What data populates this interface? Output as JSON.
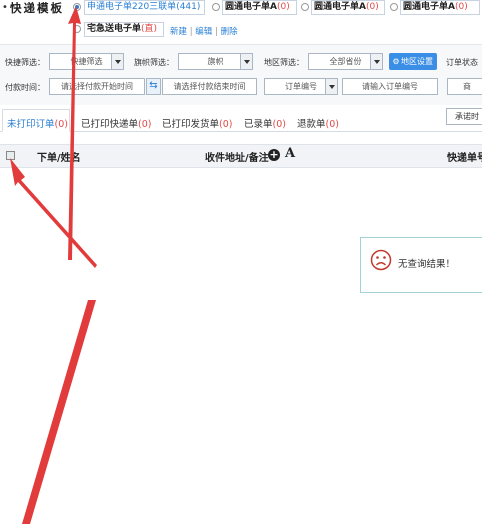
{
  "template_bar": {
    "title": "快递模板",
    "templates": [
      {
        "name": "申通电子单220三联单",
        "count": "(441)",
        "selected": true
      },
      {
        "name": "圆通电子单A",
        "count": "(0)",
        "selected": false
      },
      {
        "name": "圆通电子单A",
        "count": "(0)",
        "selected": false
      },
      {
        "name": "圆通电子单A",
        "count": "(0)",
        "selected": false
      }
    ],
    "urgent": {
      "name": "宅急送电子单",
      "badge": "(直)"
    },
    "actions": {
      "new": "新建",
      "sep": "|",
      "edit": "编辑",
      "delete": "删除"
    }
  },
  "filters": {
    "quick_label": "快捷筛选：",
    "quick_value": "快捷筛选",
    "flag_label": "旗帜筛选：",
    "flag_value": "旗帜",
    "region_label": "地区筛选：",
    "region_value": "全部省份",
    "region_button": "地区设置",
    "status_label": "订单状态",
    "pay_time_label": "付款时间：",
    "pay_start_placeholder": "请选择付款开始时间",
    "pay_end_placeholder": "请选择付款结束时间",
    "order_no_select": "订单编号",
    "order_no_placeholder": "请输入订单编号",
    "right_partial": "商"
  },
  "tabs": [
    {
      "label": "未打印订单",
      "count": "(0)",
      "active": true
    },
    {
      "label": "已打印快递单",
      "count": "(0)",
      "active": false
    },
    {
      "label": "已打印发货单",
      "count": "(0)",
      "active": false
    },
    {
      "label": "已录单",
      "count": "(0)",
      "active": false
    },
    {
      "label": "退款单",
      "count": "(0)",
      "active": false
    }
  ],
  "right_tab_button": "承诺时",
  "table": {
    "col_buyer": "下单/姓名",
    "col_address": "收件地址/备注",
    "col_font": "A",
    "col_tracking": "快递单号"
  },
  "empty_message": "无查询结果！",
  "colors": {
    "accent": "#2a7fd4",
    "count_red": "#e24a4a",
    "annotation_arrow": "#e23b3b"
  }
}
